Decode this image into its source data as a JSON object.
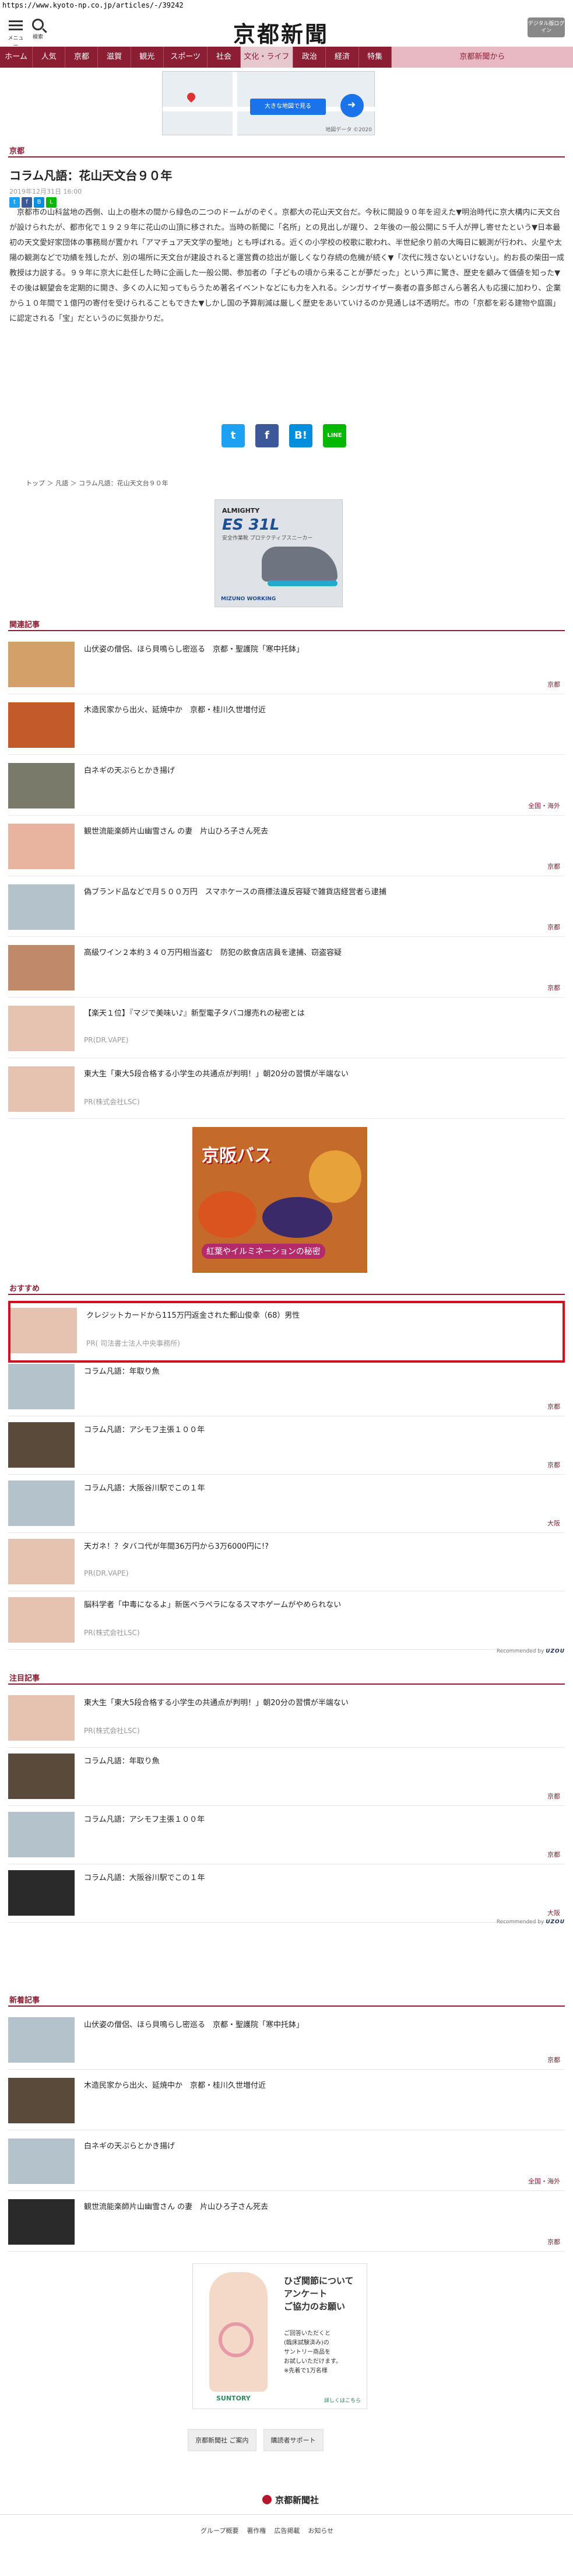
{
  "url": "https://www.kyoto-np.co.jp/articles/-/39242",
  "header": {
    "menu_label": "メニュー",
    "search_label": "検索",
    "logo": "京都新聞",
    "digital_label": "デジタル版ログイン"
  },
  "nav": [
    "ホーム",
    "人気",
    "京都",
    "滋賀",
    "観光",
    "スポーツ",
    "社会",
    "文化・ライフ",
    "政治",
    "経済",
    "特集",
    "京都新聞から"
  ],
  "map": {
    "overlay": "大きな地図で見る",
    "credit": "地図データ ©2020"
  },
  "article": {
    "section": "京都",
    "title": "コラム凡語：花山天文台９０年",
    "date": "2019年12月31日 16:00",
    "body": "京都市の山科盆地の西側、山上の樹木の間から緑色の二つのドームがのぞく。京都大の花山天文台だ。今秋に開設９０年を迎えた▼明治時代に京大構内に天文台が設けられたが、都市化で１９２９年に花山の山頂に移された。当時の新聞に「名所」との見出しが躍り、２年後の一般公開に５千人が押し寄せたという▼日本最初の天文愛好家団体の事務局が置かれ「アマチュア天文学の聖地」とも呼ばれる。近くの小学校の校歌に歌われ、半世紀余り前の大晦日に観測が行われ、火星や太陽の観測などで功績を残したが、別の場所に天文台が建設されると運営費の捻出が厳しくなり存続の危機が続く▼「次代に残さないといけない」。約お長の柴田一成教授は力説する。９９年に京大に赴任した時に企画した一般公開、参加者の「子どもの頃から来ることが夢だった」という声に驚き、歴史を顧みて価値を知った▼その後は観望会を定期的に開き、多くの人に知ってもらうため著名イベントなどにも力を入れる。シンガサイザー奏者の喜多郎さんら著名人も応援に加わり、企業から１０年間で１億円の寄付を受けられることもできた▼しかし国の予算削減は厳しく歴史をあいていけるのか見通しは不透明だ。市の「京都を彩る建物や庭園」に認定される「宝」だというのに気掛かりだ。"
  },
  "share_small": [
    "t",
    "f",
    "B",
    "L"
  ],
  "share_big": [
    "t",
    "f",
    "B!",
    "LINE"
  ],
  "breadcrumb": "トップ ＞ 凡語 ＞ コラム凡語：花山天文台９０年",
  "ad1": {
    "t1": "ALMIGHTY",
    "t2": "ES 31L",
    "t3": "安全作業靴 プロテクティブスニーカー",
    "foot": "MIZUNO WORKING"
  },
  "related": {
    "title": "関連記事",
    "items": [
      {
        "title": "山伏姿の僧侶、ほら貝鳴らし密巡る　京都・聖護院「寒中托鉢」",
        "cat": "京都"
      },
      {
        "title": "木造民家から出火、延焼中か　京都・桂川久世増付近",
        "cat": ""
      },
      {
        "title": "白ネギの天ぷらとかき揚げ",
        "cat": "全国・海外"
      },
      {
        "title": "観世流能楽師片山幽雪さん の妻　片山ひろ子さん死去",
        "cat": "京都"
      },
      {
        "title": "偽ブランド品などで月５００万円　スマホケースの商標法違反容疑で雑貨店経営者ら逮捕",
        "cat": "京都"
      },
      {
        "title": "高級ワイン２本約３４０万円相当盗む　防犯の飲食店店員を逮捕、窃盗容疑",
        "cat": "京都"
      },
      {
        "title": "【楽天１位】『マジで美味い♪』新型電子タバコ爆売れの秘密とは",
        "pr": "PR(DR.VAPE)"
      },
      {
        "title": "東大生「東大5段合格する小学生の共通点が判明！」朝20分の習慣が半端ない",
        "pr": "PR(株式会社LSC)"
      }
    ]
  },
  "ad2": {
    "banner": "京阪バス",
    "sub": "紅葉やイルミネーションの秘密"
  },
  "recommend": {
    "title": "おすすめ",
    "items": [
      {
        "title": "クレジットカードから115万円返金された郵山俊幸（68）男性",
        "pr": "PR( 司法書士法人中央事務所)"
      },
      {
        "title": "コラム凡語：年取り魚",
        "cat": "京都"
      },
      {
        "title": "コラム凡語：アシモフ主張１００年",
        "cat": "京都"
      },
      {
        "title": "コラム凡語：大阪谷川駅でこの１年",
        "cat": "大阪"
      },
      {
        "title": "天ガネ！？タバコ代が年間36万円から3万6000円に!?",
        "pr": "PR(DR.VAPE)"
      },
      {
        "title": "脳科学者「中毒になるよ」新医ベラペラになるスマホゲームがやめられない",
        "pr": "PR(株式会社LSC)"
      }
    ],
    "by": "Recommended by",
    "brand": "UZOU"
  },
  "notice": {
    "title": "注目記事",
    "items": [
      {
        "title": "東大生「東大5段合格する小学生の共通点が判明！」朝20分の習慣が半端ない",
        "pr": "PR(株式会社LSC)"
      },
      {
        "title": "コラム凡語：年取り魚",
        "cat": "京都"
      },
      {
        "title": "コラム凡語：アシモフ主張１００年",
        "cat": "京都"
      },
      {
        "title": "コラム凡語：大阪谷川駅でこの１年",
        "cat": "大阪"
      }
    ],
    "by": "Recommended by",
    "brand": "UZOU"
  },
  "latest": {
    "title": "新着記事",
    "items": [
      {
        "title": "山伏姿の僧侶、ほら貝鳴らし密巡る　京都・聖護院「寒中托鉢」",
        "cat": "京都"
      },
      {
        "title": "木造民家から出火、延焼中か　京都・桂川久世増付近",
        "cat": ""
      },
      {
        "title": "白ネギの天ぷらとかき揚げ",
        "cat": "全国・海外"
      },
      {
        "title": "観世流能楽師片山幽雪さん の妻　片山ひろ子さん死去",
        "cat": "京都"
      }
    ]
  },
  "ad3": {
    "text": "ひざ関節について\nアンケート\nご協力のお願い",
    "small": "ご回答いただくと\n(臨床試験済み)の\nサントリー商品を\nお試しいただけます。\n※先着で1万名様",
    "sponsor": "SUNTORY",
    "detail": "詳しくはこちら"
  },
  "footer_buttons": [
    "京都新聞社 ご案内",
    "購読者サポート"
  ],
  "footer_logo": "京都新聞社",
  "footer_links": [
    "グループ概要",
    "著作権",
    "広告掲載",
    "お知らせ"
  ],
  "colors": {
    "brand": "#8c1e33",
    "highlight": "#d40d1d"
  }
}
